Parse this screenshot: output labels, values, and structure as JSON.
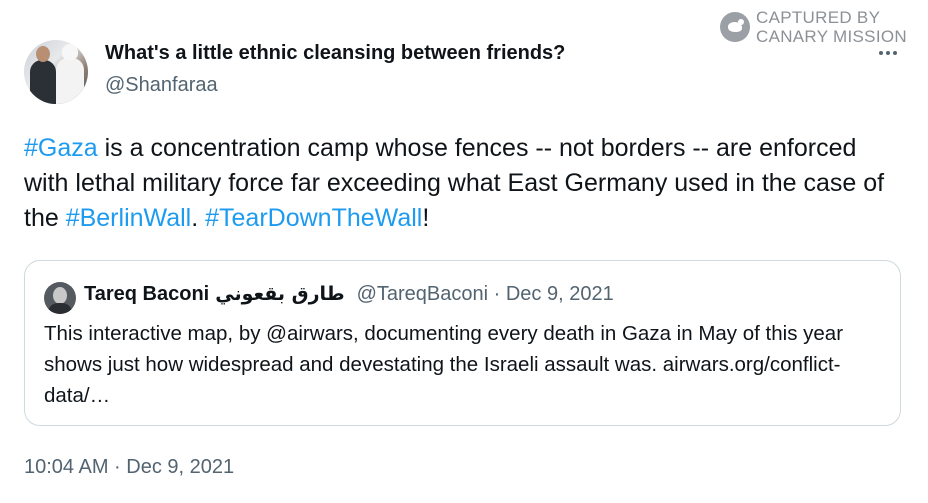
{
  "watermark": {
    "line1": "CAPTURED BY",
    "line2": "CANARY MISSION"
  },
  "tweet": {
    "display_name": "What's a little ethnic cleansing between friends?",
    "handle": "@Shanfaraa",
    "text_parts": {
      "p1": "#Gaza",
      "p2": " is a concentration camp whose fences -- not borders -- are enforced with lethal military force far exceeding what East Germany used in the case of the ",
      "p3": "#BerlinWall",
      "p4": ". ",
      "p5": "#TearDownTheWall",
      "p6": "!"
    },
    "timestamp": "10:04 AM · Dec 9, 2021"
  },
  "quoted_tweet": {
    "name": "Tareq Baconi",
    "name_arabic": "طارق بقعوني",
    "meta": "@TareqBaconi · Dec 9, 2021",
    "text": "This interactive map, by @airwars, documenting every death in Gaza in May of this year shows just how widespread and devestating the Israeli assault was. airwars.org/conflict-data/…"
  },
  "icons": {
    "more": "more-horizontal-icon",
    "watermark_logo": "canary-bird-icon"
  },
  "colors": {
    "link": "#1d9bf0",
    "secondary_text": "#536471",
    "border": "#cfd9de"
  }
}
